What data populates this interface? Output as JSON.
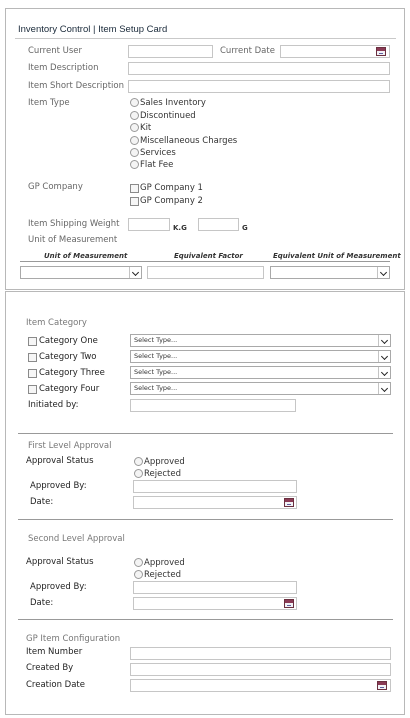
{
  "header": {
    "title": "Inventory Control | Item Setup Card"
  },
  "top_form": {
    "current_user_label": "Current User",
    "current_date_label": "Current Date",
    "item_description_label": "Item Description",
    "item_short_description_label": "Item Short Description",
    "item_type_label": "Item Type",
    "item_type_options": [
      "Sales Inventory",
      "Discontinued",
      "Kit",
      "Miscellaneous Charges",
      "Services",
      "Flat Fee"
    ],
    "gp_company_label": "GP Company",
    "gp_company_options": [
      "GP Company 1",
      "GP Company 2"
    ],
    "item_shipping_weight_label": "Item Shipping Weight",
    "weight_unit_kg": "K.G",
    "weight_unit_g": "G",
    "unit_of_measurement_label": "Unit of Measurement",
    "uom_table_headers": [
      "Unit of Measurement",
      "Equivalent Factor",
      "Equivalent Unit of Measurement"
    ]
  },
  "category_section": {
    "title": "Item Category",
    "categories": [
      {
        "label": "Category One",
        "select": "Select Type..."
      },
      {
        "label": "Category Two",
        "select": "Select Type..."
      },
      {
        "label": "Category Three",
        "select": "Select Type..."
      },
      {
        "label": "Category Four",
        "select": "Select Type..."
      }
    ],
    "initiated_by_label": "Initiated by:"
  },
  "first_approval": {
    "title": "First Level Approval",
    "status_label": "Approval Status",
    "options": [
      "Approved",
      "Rejected"
    ],
    "approved_by_label": "Approved By:",
    "date_label": "Date:"
  },
  "second_approval": {
    "title": "Second Level Approval",
    "status_label": "Approval Status",
    "options": [
      "Approved",
      "Rejected"
    ],
    "approved_by_label": "Approved By:",
    "date_label": "Date:"
  },
  "gp_config": {
    "title": "GP Item Configuration",
    "item_number_label": "Item Number",
    "created_by_label": "Created By",
    "creation_date_label": "Creation Date"
  },
  "icons": {
    "calendar": "calendar-icon",
    "dropdown": "chevron-down-icon"
  },
  "colors": {
    "border": "#b8b8b8",
    "input_border": "#c6c6c6",
    "calendar": "#8a3a55"
  }
}
